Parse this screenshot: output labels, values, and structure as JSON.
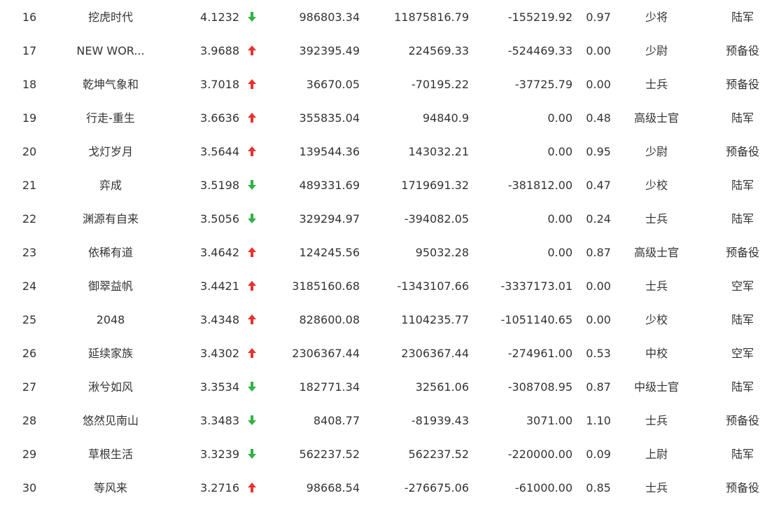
{
  "colors": {
    "up": "#e8312f",
    "down": "#2fb344",
    "text": "#333333"
  },
  "rows": [
    {
      "rank": "16",
      "name": "挖虎时代",
      "score": "4.1232",
      "trend": "down",
      "trend_icon": "down-arrow-icon",
      "v1": "986803.34",
      "v2": "11875816.79",
      "v3": "-155219.92",
      "ratio": "0.97",
      "title": "少将",
      "branch": "陆军"
    },
    {
      "rank": "17",
      "name": "NEW WOR...",
      "score": "3.9688",
      "trend": "up",
      "trend_icon": "up-arrow-icon",
      "v1": "392395.49",
      "v2": "224569.33",
      "v3": "-524469.33",
      "ratio": "0.00",
      "title": "少尉",
      "branch": "预备役"
    },
    {
      "rank": "18",
      "name": "乾坤气象和",
      "score": "3.7018",
      "trend": "up",
      "trend_icon": "up-arrow-icon",
      "v1": "36670.05",
      "v2": "-70195.22",
      "v3": "-37725.79",
      "ratio": "0.00",
      "title": "士兵",
      "branch": "预备役"
    },
    {
      "rank": "19",
      "name": "行走-重生",
      "score": "3.6636",
      "trend": "up",
      "trend_icon": "up-arrow-icon",
      "v1": "355835.04",
      "v2": "94840.9",
      "v3": "0.00",
      "ratio": "0.48",
      "title": "高级士官",
      "branch": "陆军"
    },
    {
      "rank": "20",
      "name": "戈灯岁月",
      "score": "3.5644",
      "trend": "up",
      "trend_icon": "up-arrow-icon",
      "v1": "139544.36",
      "v2": "143032.21",
      "v3": "0.00",
      "ratio": "0.95",
      "title": "少尉",
      "branch": "预备役"
    },
    {
      "rank": "21",
      "name": "弈成",
      "score": "3.5198",
      "trend": "down",
      "trend_icon": "down-arrow-icon",
      "v1": "489331.69",
      "v2": "1719691.32",
      "v3": "-381812.00",
      "ratio": "0.47",
      "title": "少校",
      "branch": "陆军"
    },
    {
      "rank": "22",
      "name": "渊源有自来",
      "score": "3.5056",
      "trend": "down",
      "trend_icon": "down-arrow-icon",
      "v1": "329294.97",
      "v2": "-394082.05",
      "v3": "0.00",
      "ratio": "0.24",
      "title": "士兵",
      "branch": "陆军"
    },
    {
      "rank": "23",
      "name": "依稀有道",
      "score": "3.4642",
      "trend": "up",
      "trend_icon": "up-arrow-icon",
      "v1": "124245.56",
      "v2": "95032.28",
      "v3": "0.00",
      "ratio": "0.87",
      "title": "高级士官",
      "branch": "预备役"
    },
    {
      "rank": "24",
      "name": "御翠益帆",
      "score": "3.4421",
      "trend": "up",
      "trend_icon": "up-arrow-icon",
      "v1": "3185160.68",
      "v2": "-1343107.66",
      "v3": "-3337173.01",
      "ratio": "0.00",
      "title": "士兵",
      "branch": "空军"
    },
    {
      "rank": "25",
      "name": "2048",
      "score": "3.4348",
      "trend": "up",
      "trend_icon": "up-arrow-icon",
      "v1": "828600.08",
      "v2": "1104235.77",
      "v3": "-1051140.65",
      "ratio": "0.00",
      "title": "少校",
      "branch": "陆军"
    },
    {
      "rank": "26",
      "name": "延续家族",
      "score": "3.4302",
      "trend": "up",
      "trend_icon": "up-arrow-icon",
      "v1": "2306367.44",
      "v2": "2306367.44",
      "v3": "-274961.00",
      "ratio": "0.53",
      "title": "中校",
      "branch": "空军"
    },
    {
      "rank": "27",
      "name": "湫兮如风",
      "score": "3.3534",
      "trend": "down",
      "trend_icon": "down-arrow-icon",
      "v1": "182771.34",
      "v2": "32561.06",
      "v3": "-308708.95",
      "ratio": "0.87",
      "title": "中级士官",
      "branch": "陆军"
    },
    {
      "rank": "28",
      "name": "悠然见南山",
      "score": "3.3483",
      "trend": "down",
      "trend_icon": "down-arrow-icon",
      "v1": "8408.77",
      "v2": "-81939.43",
      "v3": "3071.00",
      "ratio": "1.10",
      "title": "士兵",
      "branch": "预备役"
    },
    {
      "rank": "29",
      "name": "草根生活",
      "score": "3.3239",
      "trend": "down",
      "trend_icon": "down-arrow-icon",
      "v1": "562237.52",
      "v2": "562237.52",
      "v3": "-220000.00",
      "ratio": "0.09",
      "title": "上尉",
      "branch": "陆军"
    },
    {
      "rank": "30",
      "name": "等风来",
      "score": "3.2716",
      "trend": "up",
      "trend_icon": "up-arrow-icon",
      "v1": "98668.54",
      "v2": "-276675.06",
      "v3": "-61000.00",
      "ratio": "0.85",
      "title": "士兵",
      "branch": "预备役"
    }
  ]
}
